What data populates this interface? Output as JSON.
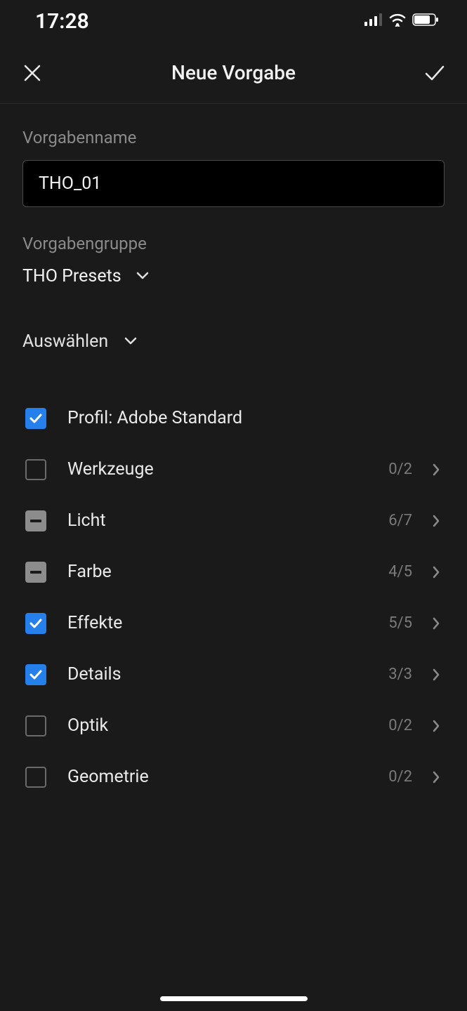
{
  "status": {
    "time": "17:28"
  },
  "header": {
    "title": "Neue Vorgabe"
  },
  "form": {
    "name_label": "Vorgabenname",
    "name_value": "THO_01",
    "group_label": "Vorgabengruppe",
    "group_value": "THO Presets",
    "select_label": "Auswählen"
  },
  "items": [
    {
      "label": "Profil: Adobe Standard",
      "state": "checked",
      "count": "",
      "has_chevron": false
    },
    {
      "label": "Werkzeuge",
      "state": "empty",
      "count": "0/2",
      "has_chevron": true
    },
    {
      "label": "Licht",
      "state": "indeterminate",
      "count": "6/7",
      "has_chevron": true
    },
    {
      "label": "Farbe",
      "state": "indeterminate",
      "count": "4/5",
      "has_chevron": true
    },
    {
      "label": "Effekte",
      "state": "checked",
      "count": "5/5",
      "has_chevron": true
    },
    {
      "label": "Details",
      "state": "checked",
      "count": "3/3",
      "has_chevron": true
    },
    {
      "label": "Optik",
      "state": "empty",
      "count": "0/2",
      "has_chevron": true
    },
    {
      "label": "Geometrie",
      "state": "empty",
      "count": "0/2",
      "has_chevron": true
    }
  ]
}
